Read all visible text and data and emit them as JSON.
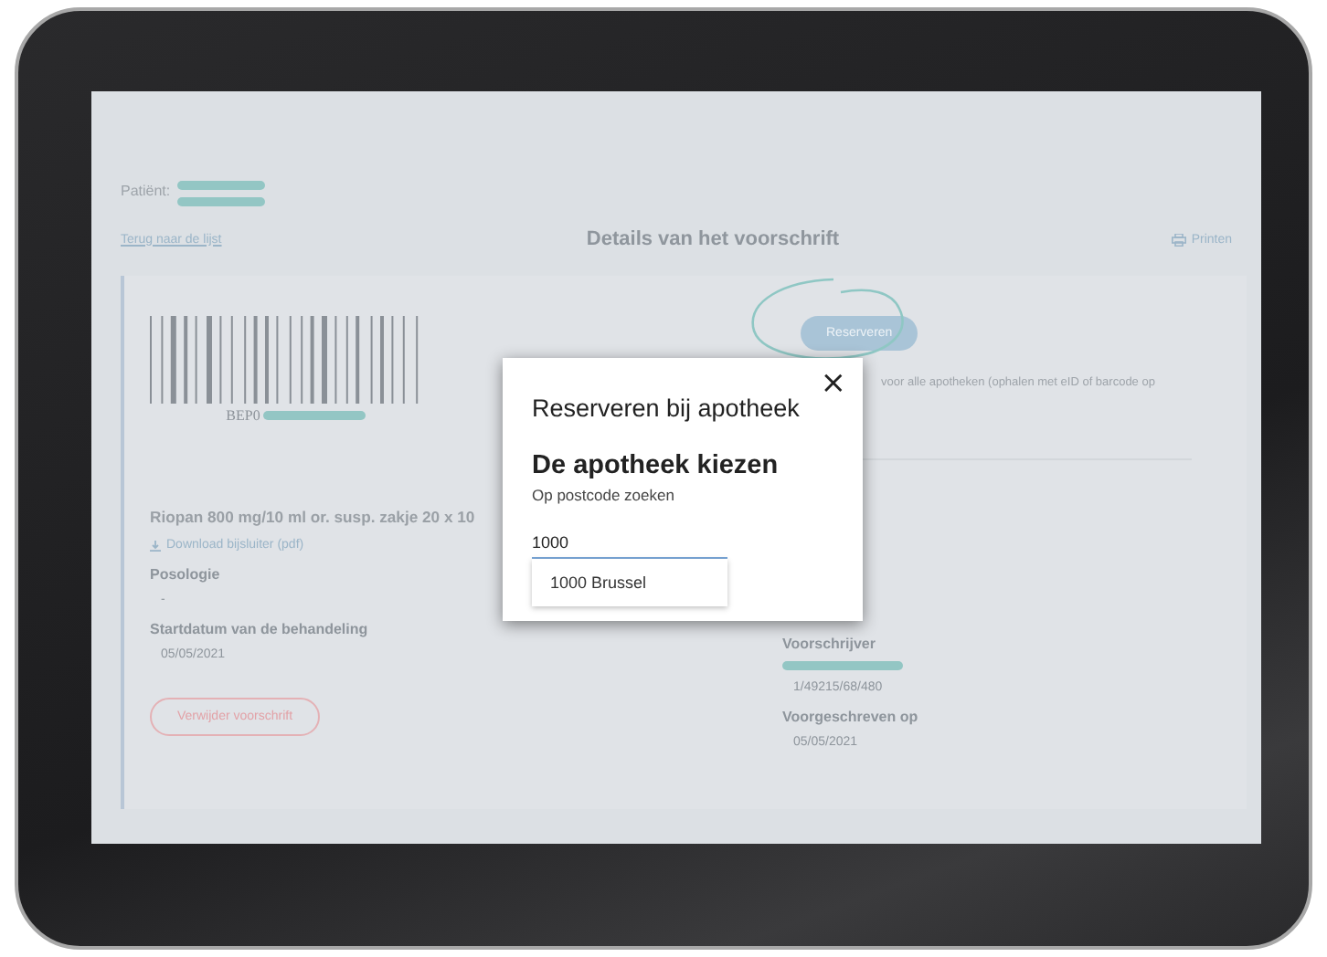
{
  "patient": {
    "label": "Patiënt:"
  },
  "back_link": "Terug naar de lijst",
  "page_title": "Details van het voorschrift",
  "print_link": "Printen",
  "prescription": {
    "barcode_prefix": "BEP0",
    "medication": "Riopan 800 mg/10 ml or. susp. zakje 20 x 10",
    "download_link": "Download bijsluiter (pdf)",
    "fields": [
      {
        "label": "Posologie",
        "value": "-"
      },
      {
        "label": "Startdatum van de behandeling",
        "value": "05/05/2021"
      }
    ],
    "delete_button": "Verwijder voorschrift"
  },
  "reservation": {
    "button": "Reserveren",
    "note": "voor alle apotheken (ophalen met eID of barcode op"
  },
  "prescriber": {
    "fields": [
      {
        "label": "Voorschrijver",
        "value": "1/49215/68/480",
        "redacted": true
      },
      {
        "label": "Voorgeschreven op",
        "value": "05/05/2021",
        "redacted": false
      }
    ]
  },
  "modal": {
    "title": "Reserveren bij apotheek",
    "close": "×",
    "heading": "De apotheek kiezen",
    "field_label": "Op postcode zoeken",
    "value": "1000",
    "suggestions": [
      "1000 Brussel"
    ]
  }
}
